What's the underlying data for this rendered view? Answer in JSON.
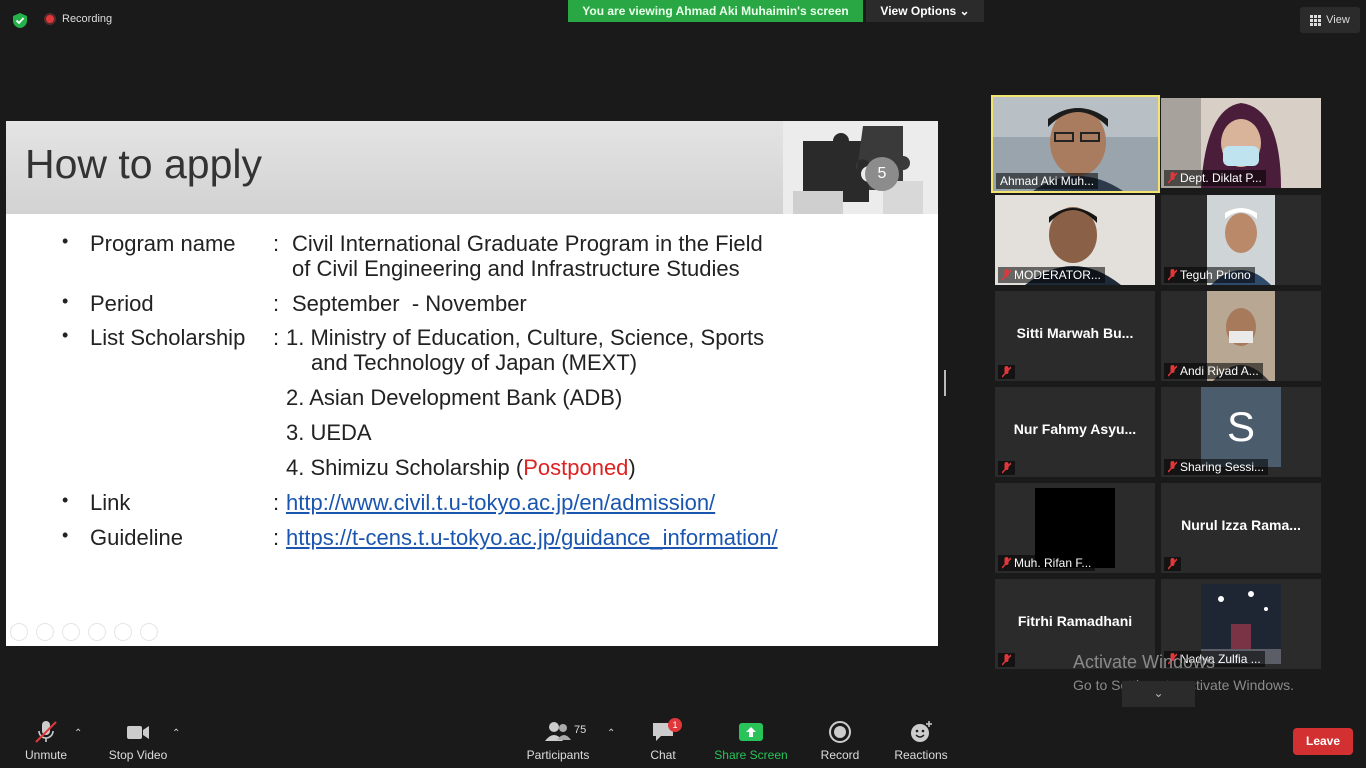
{
  "topbar": {
    "recording_label": "Recording",
    "viewing_banner": "You are viewing Ahmad Aki Muhaimin's screen",
    "view_options_label": "View Options ⌄",
    "view_label": "View"
  },
  "slide": {
    "title": "How to apply",
    "page_number": "5",
    "rows": {
      "program_label": "Program name",
      "program_value_1": "Civil International Graduate Program in the Field",
      "program_value_2": "of Civil Engineering and Infrastructure Studies",
      "period_label": "Period",
      "period_value": "September  - November",
      "scholarship_label": "List Scholarship",
      "scholarship_1a": "1. Ministry of Education, Culture, Science, Sports",
      "scholarship_1b": "and Technology of Japan (MEXT)",
      "scholarship_2": "2. Asian Development Bank (ADB)",
      "scholarship_3": "3. UEDA",
      "scholarship_4_prefix": "4. Shimizu Scholarship (",
      "scholarship_4_status": "Postponed",
      "scholarship_4_suffix": ")",
      "link_label": "Link",
      "link_value": "http://www.civil.t.u-tokyo.ac.jp/en/admission/",
      "guideline_label": "Guideline",
      "guideline_value": "https://t-cens.t.u-tokyo.ac.jp/guidance_information/"
    },
    "bullet": "•",
    "colon": ":"
  },
  "participants_panel": [
    {
      "name": "Ahmad Aki Muh...",
      "type": "video",
      "muted": false,
      "active": true
    },
    {
      "name": "Dept. Diklat P...",
      "type": "video",
      "muted": true,
      "active": false
    },
    {
      "name": "MODERATOR...",
      "type": "video",
      "muted": true,
      "active": false
    },
    {
      "name": "Teguh Priono",
      "type": "video",
      "muted": true,
      "active": false
    },
    {
      "name": "Sitti Marwah Bu...",
      "type": "name",
      "muted": true,
      "active": false
    },
    {
      "name": "Andi Riyad A...",
      "type": "video",
      "muted": true,
      "active": false
    },
    {
      "name": "Nur Fahmy Asyu...",
      "type": "name",
      "muted": true,
      "active": false
    },
    {
      "name": "Sharing Sessi...",
      "type": "avatar",
      "avatar_letter": "S",
      "muted": true,
      "active": false
    },
    {
      "name": "Muh. Rifan F...",
      "type": "video",
      "muted": true,
      "active": false
    },
    {
      "name": "Nurul Izza Rama...",
      "type": "name",
      "muted": true,
      "active": false
    },
    {
      "name": "Fitrhi Ramadhani",
      "type": "name",
      "muted": true,
      "active": false
    },
    {
      "name": "Nadya Zulfia ...",
      "type": "video",
      "muted": true,
      "active": false
    }
  ],
  "tiles": {
    "t0": "Ahmad Aki Muh...",
    "t1": "Dept. Diklat P...",
    "t2": "MODERATOR...",
    "t3": "Teguh Priono",
    "t4": "Sitti Marwah Bu...",
    "t5": "Andi Riyad A...",
    "t6": "Nur Fahmy Asyu...",
    "t7": "Sharing Sessi...",
    "t7_letter": "S",
    "t8": "Muh. Rifan F...",
    "t9": "Nurul Izza Rama...",
    "t10": "Fitrhi Ramadhani",
    "t11": "Nadya Zulfia ..."
  },
  "watermark": {
    "line1": "Activate Windows",
    "line2": "Go to Settings to activate Windows."
  },
  "toolbar": {
    "unmute_label": "Unmute",
    "stop_video_label": "Stop Video",
    "participants_label": "Participants",
    "participants_count": "75",
    "chat_label": "Chat",
    "chat_badge": "1",
    "share_screen_label": "Share Screen",
    "record_label": "Record",
    "reactions_label": "Reactions",
    "leave_label": "Leave"
  },
  "colors": {
    "banner_green": "#29a745",
    "share_green": "#29c35a",
    "leave_red": "#d33131",
    "active_speaker": "#f2e46f",
    "postponed_red": "#d22222",
    "link_blue": "#1a56b0"
  }
}
